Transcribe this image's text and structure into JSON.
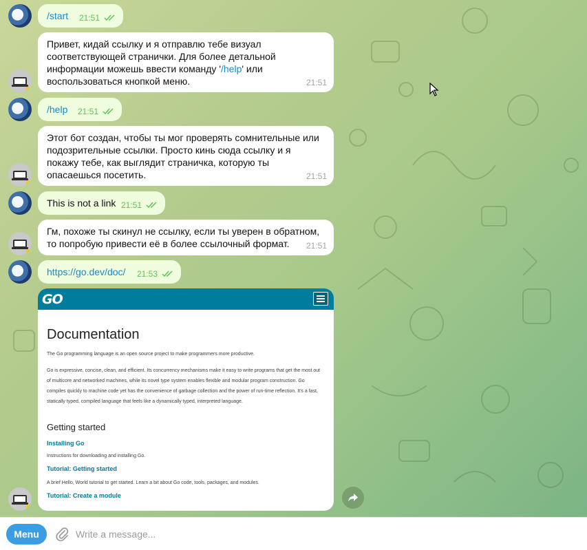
{
  "messages": [
    {
      "dir": "out",
      "text": "/start",
      "time": "21:51"
    },
    {
      "dir": "in",
      "text_before": "Привет, кидай ссылку и я отправлю тебе визуал соответствующей странички. Для более детальной информации можешь ввести команду '",
      "link": "/help",
      "text_after": "' или воспользоваться кнопкой меню.",
      "time": "21:51"
    },
    {
      "dir": "out",
      "text": "/help",
      "time": "21:51"
    },
    {
      "dir": "in",
      "text": "Этот бот создан, чтобы ты мог проверять сомнительные или подозрительные ссылки. Просто кинь сюда ссылку и я покажу тебе, как выглядит страничка, которую ты опасаешься посетить.",
      "time": "21:51"
    },
    {
      "dir": "out",
      "text": "This is not a link",
      "time": "21:51"
    },
    {
      "dir": "in",
      "text": "Гм, похоже ты скинул не ссылку, если ты уверен в обратном, то попробую привести её в более ссылочный формат.",
      "time": "21:51"
    },
    {
      "dir": "out",
      "text": "https://go.dev/doc/",
      "time": "21:53"
    }
  ],
  "preview": {
    "logo": "GO",
    "title": "Documentation",
    "intro": "The Go programming language is an open source project to make programmers more productive.",
    "para": "Go is expressive, concise, clean, and efficient. Its concurrency mechanisms make it easy to write programs that get the most out of multicore and networked machines, while its novel type system enables flexible and modular program construction. Go compiles quickly to machine code yet has the convenience of garbage collection and the power of run-time reflection. It's a fast, statically typed, compiled language that feels like a dynamically typed, interpreted language.",
    "section": "Getting started",
    "items": [
      {
        "title": "Installing Go",
        "desc": "Instructions for downloading and installing Go."
      },
      {
        "title": "Tutorial: Getting started",
        "desc": "A brief Hello, World tutorial to get started. Learn a bit about Go code, tools, packages, and modules."
      },
      {
        "title": "Tutorial: Create a module",
        "desc": ""
      }
    ]
  },
  "composer": {
    "menu_label": "Menu",
    "placeholder": "Write a message..."
  },
  "colors": {
    "outgoing_bubble": "#effdde",
    "incoming_bubble": "#ffffff",
    "link": "#168acd",
    "read_checks": "#5dc452",
    "go_brand": "#007d9c",
    "menu_button": "#3b9ee2"
  },
  "icons": [
    "double-check-icon",
    "share-icon",
    "paperclip-icon",
    "hamburger-menu-icon",
    "mouse-cursor-icon"
  ]
}
